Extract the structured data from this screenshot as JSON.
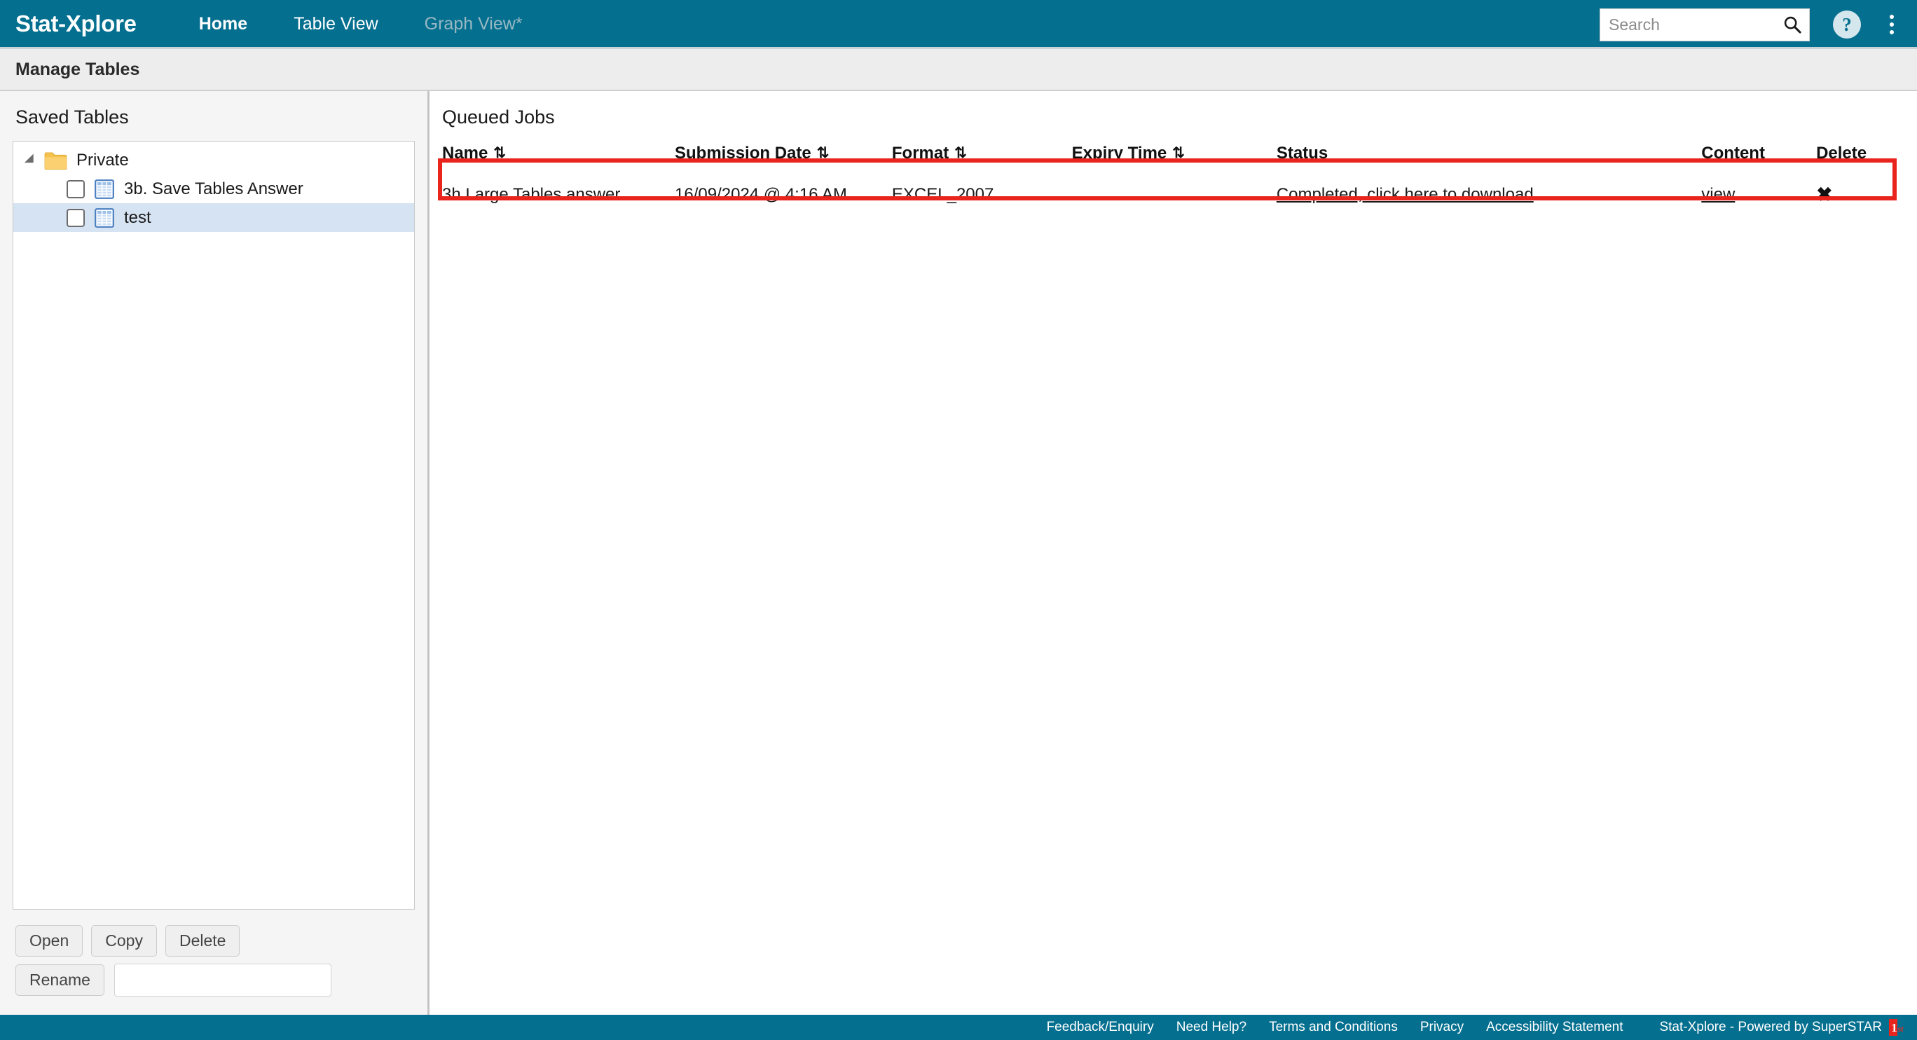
{
  "nav": {
    "brand": "Stat-Xplore",
    "links": [
      {
        "label": "Home",
        "state": "active"
      },
      {
        "label": "Table View",
        "state": "normal"
      },
      {
        "label": "Graph View*",
        "state": "disabled"
      }
    ],
    "search": {
      "placeholder": "Search",
      "value": ""
    },
    "search_icon": "search-icon",
    "help_icon": "?",
    "kebab_icon": "overflow-menu-icon"
  },
  "titlebar": {
    "title": "Manage Tables"
  },
  "sidebar": {
    "heading": "Saved Tables",
    "tree": {
      "root": {
        "label": "Private",
        "icon": "folder-icon",
        "expanded": true
      },
      "children": [
        {
          "label": "3b. Save Tables Answer",
          "icon": "table-icon",
          "checked": false,
          "selected": false
        },
        {
          "label": "test",
          "icon": "table-icon",
          "checked": false,
          "selected": true
        }
      ]
    },
    "buttons": {
      "open": "Open",
      "copy": "Copy",
      "delete": "Delete",
      "rename": "Rename"
    },
    "rename_input": {
      "value": "",
      "placeholder": ""
    }
  },
  "main": {
    "heading": "Queued Jobs",
    "columns": [
      {
        "label": "Name",
        "sortable": true
      },
      {
        "label": "Submission Date",
        "sortable": true
      },
      {
        "label": "Format",
        "sortable": true
      },
      {
        "label": "Expiry Time",
        "sortable": true
      },
      {
        "label": "Status",
        "sortable": false
      },
      {
        "label": "Content",
        "sortable": false
      },
      {
        "label": "Delete",
        "sortable": false
      }
    ],
    "sort_glyph": "⇅",
    "rows": [
      {
        "name": "3h Large Tables answer",
        "submission_date": "16/09/2024 @ 4:16 AM",
        "format": "EXCEL_2007",
        "expiry_time": "",
        "status": "Completed, click here to download",
        "content": "view",
        "delete": "✖"
      }
    ],
    "annotation_color": "#e8241c"
  },
  "footer": {
    "links": [
      "Feedback/Enquiry",
      "Need Help?",
      "Terms and Conditions",
      "Privacy",
      "Accessibility Statement"
    ],
    "brand": "Stat-Xplore - Powered by SuperSTAR",
    "logo": "1st-logo-icon"
  },
  "colors": {
    "accent": "#046f8f",
    "titlebar": "#ededed",
    "sidebar_bg": "#f5f5f5",
    "selection": "#d6e3f3",
    "annotation": "#e8241c",
    "folder": "#f5c34b"
  }
}
